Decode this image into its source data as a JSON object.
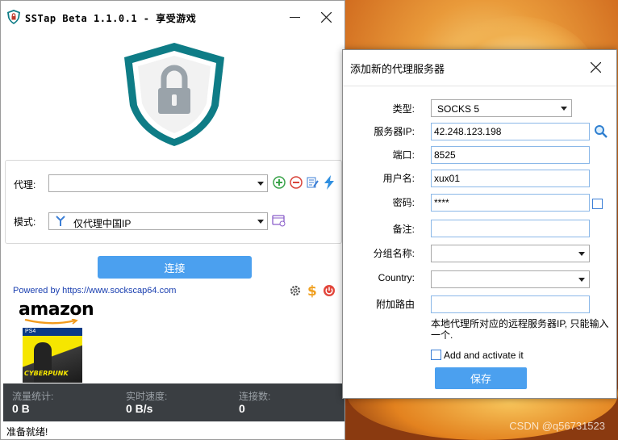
{
  "main_window": {
    "title": "SSTap Beta 1.1.0.1 - 享受游戏",
    "proxy_label": "代理:",
    "proxy_value": "",
    "mode_label": "模式:",
    "mode_value": "仅代理中国IP",
    "connect_label": "连接",
    "powered_by": "Powered by https://www.sockscap64.com",
    "ad": {
      "brand": "amazon",
      "platform": "PS4",
      "game_title": "CYBERPUNK"
    },
    "stats": [
      {
        "label": "流量统计:",
        "value": "0 B"
      },
      {
        "label": "实时速度:",
        "value": "0 B/s"
      },
      {
        "label": "连接数:",
        "value": "0"
      }
    ],
    "status": "准备就绪!"
  },
  "dialog": {
    "title": "添加新的代理服务器",
    "fields": {
      "type": {
        "label": "类型:",
        "value": "SOCKS 5"
      },
      "server_ip": {
        "label": "服务器IP:",
        "value": "42.248.123.198"
      },
      "port": {
        "label": "端口:",
        "value": "8525"
      },
      "username": {
        "label": "用户名:",
        "value": "xux01"
      },
      "password": {
        "label": "密码:",
        "value": "****"
      },
      "note": {
        "label": "备注:",
        "value": ""
      },
      "group": {
        "label": "分组名称:",
        "value": ""
      },
      "country": {
        "label": "Country:",
        "value": ""
      },
      "extra_route": {
        "label": "附加路由",
        "value": ""
      }
    },
    "hint": "本地代理所对应的远程服务器IP, 只能输入一个.",
    "add_activate_label": "Add and activate it",
    "save_label": "保存"
  },
  "watermark": "CSDN @q56731523",
  "colors": {
    "accent_blue": "#4ba0ef",
    "stats_bg": "#3a3e42",
    "shield_teal": "#0e7c86"
  },
  "icons": [
    "app-shield-icon",
    "minimize-icon",
    "close-icon",
    "lock-shield-icon",
    "add-icon",
    "remove-icon",
    "edit-icon",
    "lightning-icon",
    "mode-globe-icon",
    "mode-settings-icon",
    "gear-icon",
    "dollar-icon",
    "power-icon",
    "search-icon"
  ]
}
